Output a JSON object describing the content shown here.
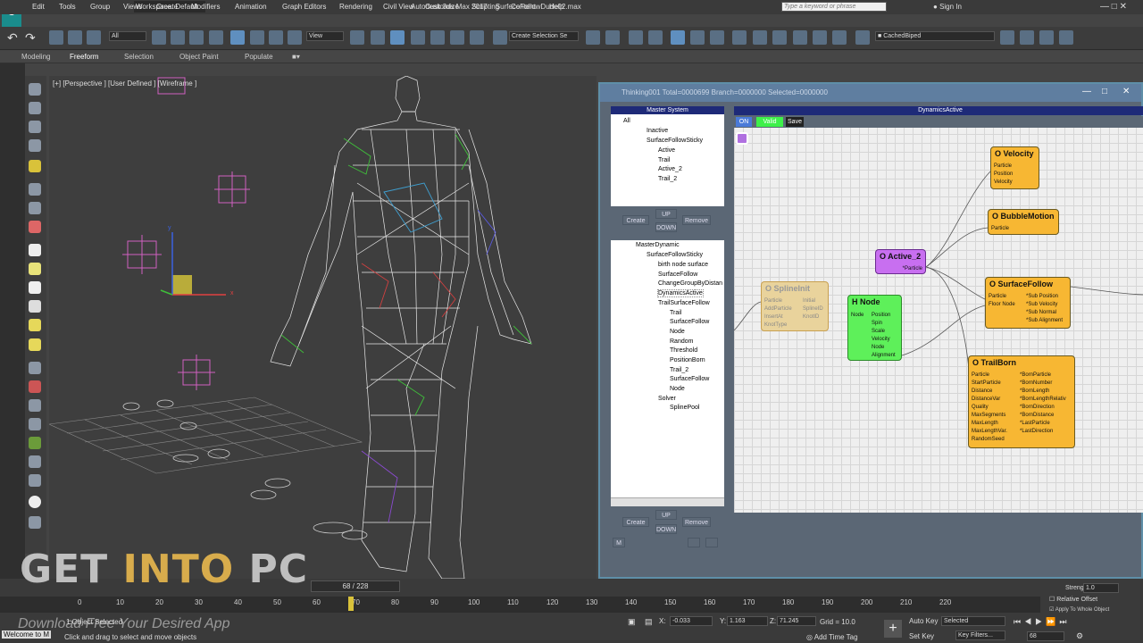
{
  "menubar": {
    "title": "Autodesk 3ds Max 2017",
    "file": "SurfeceFollowDude02.max",
    "workspace": "Workspace: Default",
    "items": [
      "Edit",
      "Tools",
      "Group",
      "Views",
      "Create",
      "Modifiers",
      "Animation",
      "Graph Editors",
      "Rendering",
      "Civil View",
      "Customize",
      "Scripting",
      "Content",
      "Help"
    ],
    "search_placeholder": "Type a keyword or phrase",
    "sign_in": "Sign In"
  },
  "toolbar": {
    "filter": "All",
    "viewcombo": "View",
    "selection_set": "Create Selection Se",
    "cached": "CachedBiped"
  },
  "ribbon": {
    "tabs": [
      "Modeling",
      "Freeform",
      "Selection",
      "Object Paint",
      "Populate"
    ]
  },
  "viewport": {
    "label": "[+] [Perspective ] [User Defined ] [Wireframe ]",
    "axis_x": "x",
    "axis_y": "y"
  },
  "pflow": {
    "title": "Thinking001  Total=0000699  Branch=0000000  Selected=0000000",
    "master": {
      "header": "Master System",
      "items": [
        "All",
        "Inactive",
        "SurfaceFollowSticky",
        "Active",
        "Trail",
        "Active_2",
        "Trail_2"
      ]
    },
    "buttons": {
      "create": "Create",
      "up": "UP",
      "down": "DOWN",
      "remove": "Remove",
      "m": "M"
    },
    "dynamic": {
      "items": [
        "MasterDynamic",
        "SurfaceFollowSticky",
        "birth node surface",
        "SurfaceFollow",
        "ChangeGroupByDistan",
        "DynamicsActive",
        "TrailSurfaceFollow",
        "Trail",
        "SurfaceFollow",
        "Node",
        "Random",
        "Threshold",
        "PositionBorn",
        "Trail_2",
        "SurfaceFollow",
        "Node",
        "Solver",
        "SplinePool"
      ]
    },
    "graph_header": "DynamicsActive",
    "graph_btns": {
      "on": "ON",
      "valid": "Valid",
      "save": "Save"
    },
    "nodes": {
      "velocity": {
        "title": "O Velocity",
        "ports": [
          "Particle",
          "Position",
          "Velocity"
        ]
      },
      "bubble": {
        "title": "O BubbleMotion",
        "ports": [
          "Particle"
        ]
      },
      "active2": {
        "title": "O Active_2",
        "ports": [
          "*Particle"
        ]
      },
      "surface": {
        "title": "O SurfaceFollow",
        "in": [
          "Particle",
          "Floor Node"
        ],
        "out": [
          "*Sub Position",
          "*Sub Velocity",
          "*Sub Normal",
          "*Sub Alignment"
        ]
      },
      "spline": {
        "title": "O SplineInit",
        "in": [
          "Particle",
          "AddParticle",
          "InsertAt",
          "KnotType"
        ],
        "out": [
          "Initial",
          "SplineID",
          "KnotID"
        ]
      },
      "hnode": {
        "title": "H Node",
        "in": [
          "Node"
        ],
        "out": [
          "Position",
          "Spin",
          "Scale",
          "Velocity",
          "Node",
          "Alignment"
        ]
      },
      "trail": {
        "title": "O TrailBorn",
        "in": [
          "Particle",
          "StartParticle",
          "Distance",
          "DistanceVar",
          "Quality",
          "MaxSegments",
          "MaxLength",
          "MaxLengthVar.",
          "RandomSeed"
        ],
        "out": [
          "*BornParticle",
          "*BornNumber",
          "*BornLength",
          "*BornLengthRelativ",
          "*BornDirection",
          "*BornDistance",
          "*LastParticle",
          "*LastDirection"
        ]
      }
    }
  },
  "timeline": {
    "frame": "68 / 228",
    "ticks": [
      "0",
      "10",
      "20",
      "30",
      "40",
      "50",
      "60",
      "70",
      "80",
      "90",
      "100",
      "110",
      "120",
      "130",
      "140",
      "150",
      "160",
      "170",
      "180",
      "190",
      "200",
      "210",
      "220"
    ]
  },
  "status": {
    "selected": "1 Object Selected",
    "hint": "Click and drag to select and move objects",
    "welcome": "Welcome to M",
    "x": "-0.033",
    "y": "1.163",
    "z": "71.245",
    "grid": "Grid = 10.0",
    "addtag": "Add Time Tag",
    "autokey": "Auto Key",
    "setkey": "Set Key",
    "selected_combo": "Selected",
    "keyfilters": "Key Filters...",
    "frame_field": "68",
    "strength_label": "Strength",
    "strength_val": "1.0",
    "relative": "Relative Offset",
    "apply": "Apply To Whole Object"
  },
  "watermark": {
    "get": "GET ",
    "into": "INTO",
    "pc": " PC",
    "sub": "Download Free Your Desired App"
  }
}
